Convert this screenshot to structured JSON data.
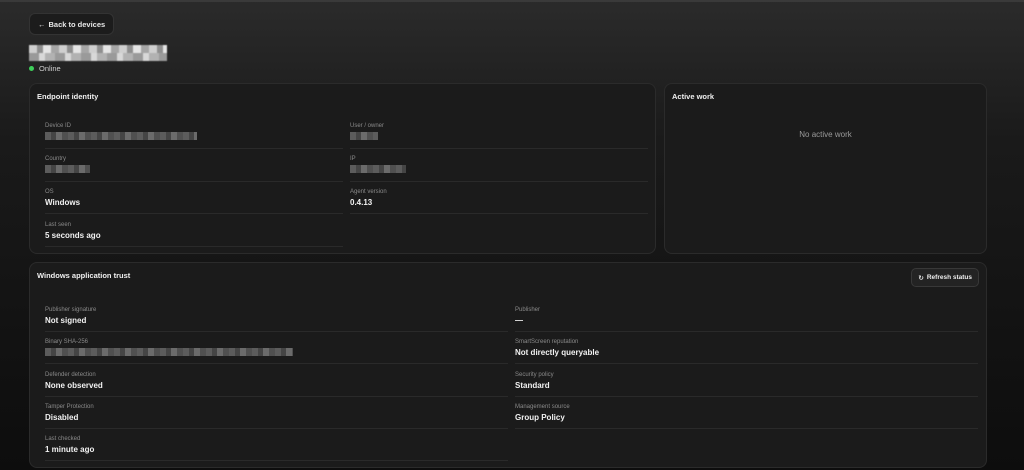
{
  "nav": {
    "back_label": "Back to devices"
  },
  "device": {
    "status": "Online"
  },
  "endpoint_identity": {
    "title": "Endpoint identity",
    "fields": {
      "device_id": {
        "label": "Device ID"
      },
      "user_owner": {
        "label": "User / owner"
      },
      "country": {
        "label": "Country"
      },
      "ip": {
        "label": "IP"
      },
      "os": {
        "label": "OS",
        "value": "Windows"
      },
      "agent_version": {
        "label": "Agent version",
        "value": "0.4.13"
      },
      "last_seen": {
        "label": "Last seen",
        "value": "5 seconds ago"
      }
    }
  },
  "active_work": {
    "title": "Active work",
    "empty_text": "No active work"
  },
  "app_trust": {
    "title": "Windows application trust",
    "refresh_label": "Refresh status",
    "fields": {
      "publisher_signature": {
        "label": "Publisher signature",
        "value": "Not signed"
      },
      "publisher": {
        "label": "Publisher",
        "value": "—"
      },
      "binary_sha": {
        "label": "Binary SHA-256"
      },
      "smartscreen": {
        "label": "SmartScreen reputation",
        "value": "Not directly queryable"
      },
      "defender": {
        "label": "Defender detection",
        "value": "None observed"
      },
      "security_policy": {
        "label": "Security policy",
        "value": "Standard"
      },
      "tamper": {
        "label": "Tamper Protection",
        "value": "Disabled"
      },
      "management": {
        "label": "Management source",
        "value": "Group Policy"
      },
      "last_checked": {
        "label": "Last checked",
        "value": "1 minute ago"
      }
    }
  },
  "colors": {
    "online": "#3ecf5a",
    "card_bg": "#1b1b1b",
    "border": "#2b2b2b"
  }
}
